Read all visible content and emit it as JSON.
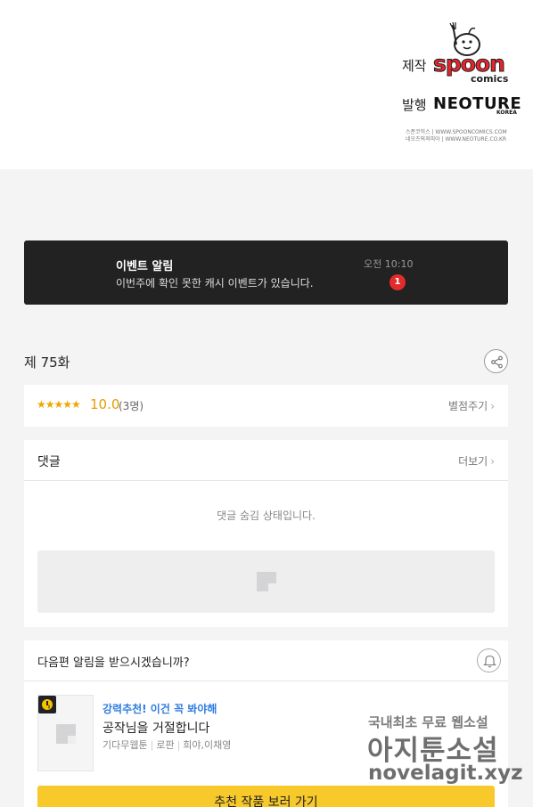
{
  "credits": {
    "produced_label": "제작",
    "publisher_label": "발행",
    "producer_logo_main": "spoon",
    "producer_logo_sub": "comics",
    "publisher_logo_main": "NEOTURE",
    "publisher_logo_sub": "KOREA",
    "info_line1": "스푼코믹스 | WWW.SPOONCOMICS.COM",
    "info_line2": "네오츠픽쳐피아 | WWW.NEOTURE.CO.KR"
  },
  "event_banner": {
    "title": "이벤트 알림",
    "message": "이번주에 확인 못한 캐시 이벤트가 있습니다.",
    "time": "오전 10:10",
    "badge_count": "1"
  },
  "episode": {
    "title": "제 75화",
    "share_icon": "share-icon"
  },
  "rating": {
    "stars": "★★★★★",
    "score": "10.0",
    "count": "(3명)",
    "rate_link": "별점주기"
  },
  "comments": {
    "heading": "댓글",
    "more_link": "더보기",
    "hidden_notice": "댓글 숨김 상태입니다."
  },
  "notify": {
    "question": "다음편 알림을 받으시겠습니까?",
    "bell_icon": "bell-icon"
  },
  "recommendation": {
    "tag": "강력추천! 이건 꼭 봐야해",
    "title": "공작님을 거절합니다",
    "meta": [
      "기다무웹툰",
      "로판",
      "희야,이채영"
    ],
    "button_label": "추천 작품 보러 가기"
  },
  "watermark": {
    "line1": "국내최초 무료 웹소설",
    "line2": "아지툰소설",
    "line3": "novelagit.xyz"
  },
  "colors": {
    "accent_yellow": "#f7c92b",
    "badge_red": "#e22b2b",
    "tag_blue": "#2f7de1",
    "star_orange": "#f0a500"
  }
}
